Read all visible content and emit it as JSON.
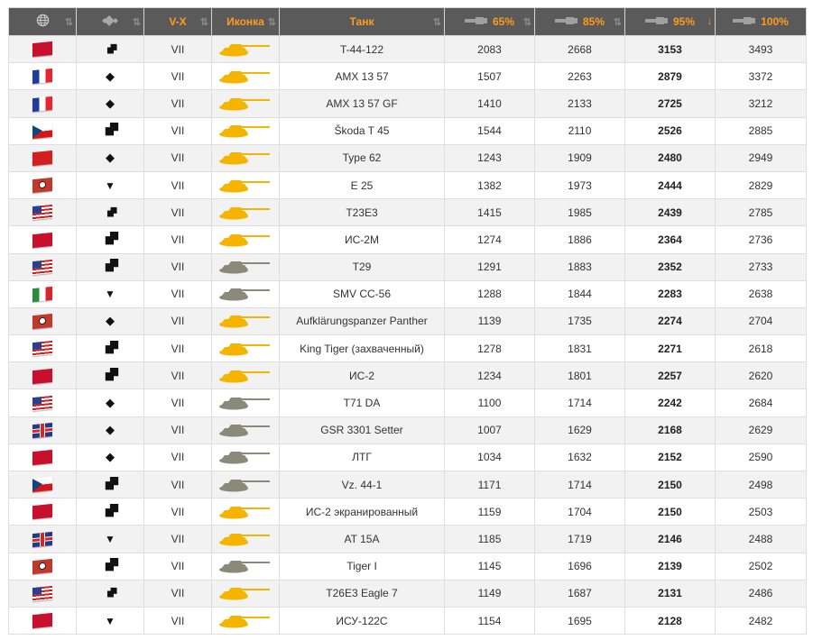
{
  "columns": {
    "nation": {
      "icon": "globe-icon"
    },
    "class": {
      "icon": "vehicle-class-icon"
    },
    "tier": {
      "label": "V-X"
    },
    "icon": {
      "label": "Иконка"
    },
    "tank": {
      "label": "Танк"
    },
    "p65": {
      "label": "65%",
      "icon": "gun-mark-icon"
    },
    "p85": {
      "label": "85%",
      "icon": "gun-mark-icon"
    },
    "p95": {
      "label": "95%",
      "icon": "gun-mark-icon"
    },
    "p100": {
      "label": "100%",
      "icon": "gun-mark-icon"
    },
    "sort_glyph": "⇅",
    "sort_active_glyph": "↓"
  },
  "colors": {
    "header_bg": "#5a5a5a",
    "header_text": "#ff9c1e",
    "tank_gold": "#f5b400",
    "tank_gray": "#8a8a7a"
  },
  "rows": [
    {
      "nation": "ussr",
      "class": "mt",
      "tier": "VII",
      "icon": "gold",
      "tank": "T-44-122",
      "p65": "2083",
      "p85": "2668",
      "p95": "3153",
      "p100": "3493"
    },
    {
      "nation": "france",
      "class": "lt",
      "tier": "VII",
      "icon": "gold",
      "tank": "AMX 13 57",
      "p65": "1507",
      "p85": "2263",
      "p95": "2879",
      "p100": "3372"
    },
    {
      "nation": "france",
      "class": "lt",
      "tier": "VII",
      "icon": "gold",
      "tank": "AMX 13 57 GF",
      "p65": "1410",
      "p85": "2133",
      "p95": "2725",
      "p100": "3212"
    },
    {
      "nation": "czech",
      "class": "ht",
      "tier": "VII",
      "icon": "gold",
      "tank": "Škoda T 45",
      "p65": "1544",
      "p85": "2110",
      "p95": "2526",
      "p100": "2885"
    },
    {
      "nation": "china",
      "class": "lt",
      "tier": "VII",
      "icon": "gold",
      "tank": "Type 62",
      "p65": "1243",
      "p85": "1909",
      "p95": "2480",
      "p100": "2949"
    },
    {
      "nation": "germany",
      "class": "td",
      "tier": "VII",
      "icon": "gold",
      "tank": "E 25",
      "p65": "1382",
      "p85": "1973",
      "p95": "2444",
      "p100": "2829"
    },
    {
      "nation": "usa",
      "class": "mt",
      "tier": "VII",
      "icon": "gold",
      "tank": "T23E3",
      "p65": "1415",
      "p85": "1985",
      "p95": "2439",
      "p100": "2785"
    },
    {
      "nation": "ussr",
      "class": "ht",
      "tier": "VII",
      "icon": "gold",
      "tank": "ИС-2М",
      "p65": "1274",
      "p85": "1886",
      "p95": "2364",
      "p100": "2736"
    },
    {
      "nation": "usa",
      "class": "ht",
      "tier": "VII",
      "icon": "gray",
      "tank": "T29",
      "p65": "1291",
      "p85": "1883",
      "p95": "2352",
      "p100": "2733"
    },
    {
      "nation": "italy",
      "class": "td",
      "tier": "VII",
      "icon": "gray",
      "tank": "SMV CC-56",
      "p65": "1288",
      "p85": "1844",
      "p95": "2283",
      "p100": "2638"
    },
    {
      "nation": "germany",
      "class": "lt",
      "tier": "VII",
      "icon": "gold",
      "tank": "Aufklärungspanzer Panther",
      "p65": "1139",
      "p85": "1735",
      "p95": "2274",
      "p100": "2704"
    },
    {
      "nation": "usa",
      "class": "ht",
      "tier": "VII",
      "icon": "gold",
      "tank": "King Tiger (захваченный)",
      "p65": "1278",
      "p85": "1831",
      "p95": "2271",
      "p100": "2618"
    },
    {
      "nation": "ussr",
      "class": "ht",
      "tier": "VII",
      "icon": "gold",
      "tank": "ИС-2",
      "p65": "1234",
      "p85": "1801",
      "p95": "2257",
      "p100": "2620"
    },
    {
      "nation": "usa",
      "class": "lt",
      "tier": "VII",
      "icon": "gray",
      "tank": "T71 DA",
      "p65": "1100",
      "p85": "1714",
      "p95": "2242",
      "p100": "2684"
    },
    {
      "nation": "uk",
      "class": "lt",
      "tier": "VII",
      "icon": "gray",
      "tank": "GSR 3301 Setter",
      "p65": "1007",
      "p85": "1629",
      "p95": "2168",
      "p100": "2629"
    },
    {
      "nation": "ussr",
      "class": "lt",
      "tier": "VII",
      "icon": "gray",
      "tank": "ЛТГ",
      "p65": "1034",
      "p85": "1632",
      "p95": "2152",
      "p100": "2590"
    },
    {
      "nation": "czech",
      "class": "ht",
      "tier": "VII",
      "icon": "gray",
      "tank": "Vz. 44-1",
      "p65": "1171",
      "p85": "1714",
      "p95": "2150",
      "p100": "2498"
    },
    {
      "nation": "ussr",
      "class": "ht",
      "tier": "VII",
      "icon": "gold",
      "tank": "ИС-2 экранированный",
      "p65": "1159",
      "p85": "1704",
      "p95": "2150",
      "p100": "2503"
    },
    {
      "nation": "uk",
      "class": "td",
      "tier": "VII",
      "icon": "gold",
      "tank": "AT 15A",
      "p65": "1185",
      "p85": "1719",
      "p95": "2146",
      "p100": "2488"
    },
    {
      "nation": "germany",
      "class": "ht",
      "tier": "VII",
      "icon": "gray",
      "tank": "Tiger I",
      "p65": "1145",
      "p85": "1696",
      "p95": "2139",
      "p100": "2502"
    },
    {
      "nation": "usa",
      "class": "mt",
      "tier": "VII",
      "icon": "gold",
      "tank": "T26E3 Eagle 7",
      "p65": "1149",
      "p85": "1687",
      "p95": "2131",
      "p100": "2486"
    },
    {
      "nation": "ussr",
      "class": "td",
      "tier": "VII",
      "icon": "gold",
      "tank": "ИСУ-122С",
      "p65": "1154",
      "p85": "1695",
      "p95": "2128",
      "p100": "2482"
    }
  ]
}
